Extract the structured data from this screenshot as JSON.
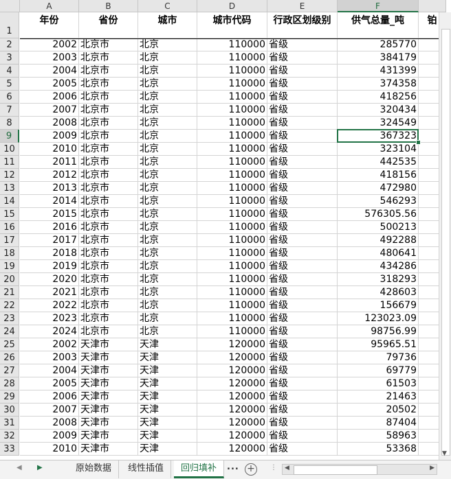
{
  "columns": [
    {
      "letter": "A",
      "header": "年份"
    },
    {
      "letter": "B",
      "header": "省份"
    },
    {
      "letter": "C",
      "header": "城市"
    },
    {
      "letter": "D",
      "header": "城市代码"
    },
    {
      "letter": "E",
      "header": "行政区划级别"
    },
    {
      "letter": "F",
      "header": "供气总量_吨"
    },
    {
      "letter": "",
      "header": "铂"
    }
  ],
  "selected_cell": "F9",
  "rows": [
    [
      "2002",
      "北京市",
      "北京",
      "110000",
      "省级",
      "285770"
    ],
    [
      "2003",
      "北京市",
      "北京",
      "110000",
      "省级",
      "384179"
    ],
    [
      "2004",
      "北京市",
      "北京",
      "110000",
      "省级",
      "431399"
    ],
    [
      "2005",
      "北京市",
      "北京",
      "110000",
      "省级",
      "374358"
    ],
    [
      "2006",
      "北京市",
      "北京",
      "110000",
      "省级",
      "418256"
    ],
    [
      "2007",
      "北京市",
      "北京",
      "110000",
      "省级",
      "320434"
    ],
    [
      "2008",
      "北京市",
      "北京",
      "110000",
      "省级",
      "324549"
    ],
    [
      "2009",
      "北京市",
      "北京",
      "110000",
      "省级",
      "367323"
    ],
    [
      "2010",
      "北京市",
      "北京",
      "110000",
      "省级",
      "323104"
    ],
    [
      "2011",
      "北京市",
      "北京",
      "110000",
      "省级",
      "442535"
    ],
    [
      "2012",
      "北京市",
      "北京",
      "110000",
      "省级",
      "418156"
    ],
    [
      "2013",
      "北京市",
      "北京",
      "110000",
      "省级",
      "472980"
    ],
    [
      "2014",
      "北京市",
      "北京",
      "110000",
      "省级",
      "546293"
    ],
    [
      "2015",
      "北京市",
      "北京",
      "110000",
      "省级",
      "576305.56"
    ],
    [
      "2016",
      "北京市",
      "北京",
      "110000",
      "省级",
      "500213"
    ],
    [
      "2017",
      "北京市",
      "北京",
      "110000",
      "省级",
      "492288"
    ],
    [
      "2018",
      "北京市",
      "北京",
      "110000",
      "省级",
      "480641"
    ],
    [
      "2019",
      "北京市",
      "北京",
      "110000",
      "省级",
      "434286"
    ],
    [
      "2020",
      "北京市",
      "北京",
      "110000",
      "省级",
      "318293"
    ],
    [
      "2021",
      "北京市",
      "北京",
      "110000",
      "省级",
      "428603"
    ],
    [
      "2022",
      "北京市",
      "北京",
      "110000",
      "省级",
      "156679"
    ],
    [
      "2023",
      "北京市",
      "北京",
      "110000",
      "省级",
      "123023.09"
    ],
    [
      "2024",
      "北京市",
      "北京",
      "110000",
      "省级",
      "98756.99"
    ],
    [
      "2002",
      "天津市",
      "天津",
      "120000",
      "省级",
      "95965.51"
    ],
    [
      "2003",
      "天津市",
      "天津",
      "120000",
      "省级",
      "79736"
    ],
    [
      "2004",
      "天津市",
      "天津",
      "120000",
      "省级",
      "69779"
    ],
    [
      "2005",
      "天津市",
      "天津",
      "120000",
      "省级",
      "61503"
    ],
    [
      "2006",
      "天津市",
      "天津",
      "120000",
      "省级",
      "21463"
    ],
    [
      "2007",
      "天津市",
      "天津",
      "120000",
      "省级",
      "20502"
    ],
    [
      "2008",
      "天津市",
      "天津",
      "120000",
      "省级",
      "87404"
    ],
    [
      "2009",
      "天津市",
      "天津",
      "120000",
      "省级",
      "58963"
    ],
    [
      "2010",
      "天津市",
      "天津",
      "120000",
      "省级",
      "53368"
    ]
  ],
  "sheet_tabs": [
    "原始数据",
    "线性插值",
    "回归填补"
  ],
  "active_tab": "回归填补",
  "tab_more": "...",
  "tab_add": "+",
  "colors": {
    "accent": "#217346"
  }
}
